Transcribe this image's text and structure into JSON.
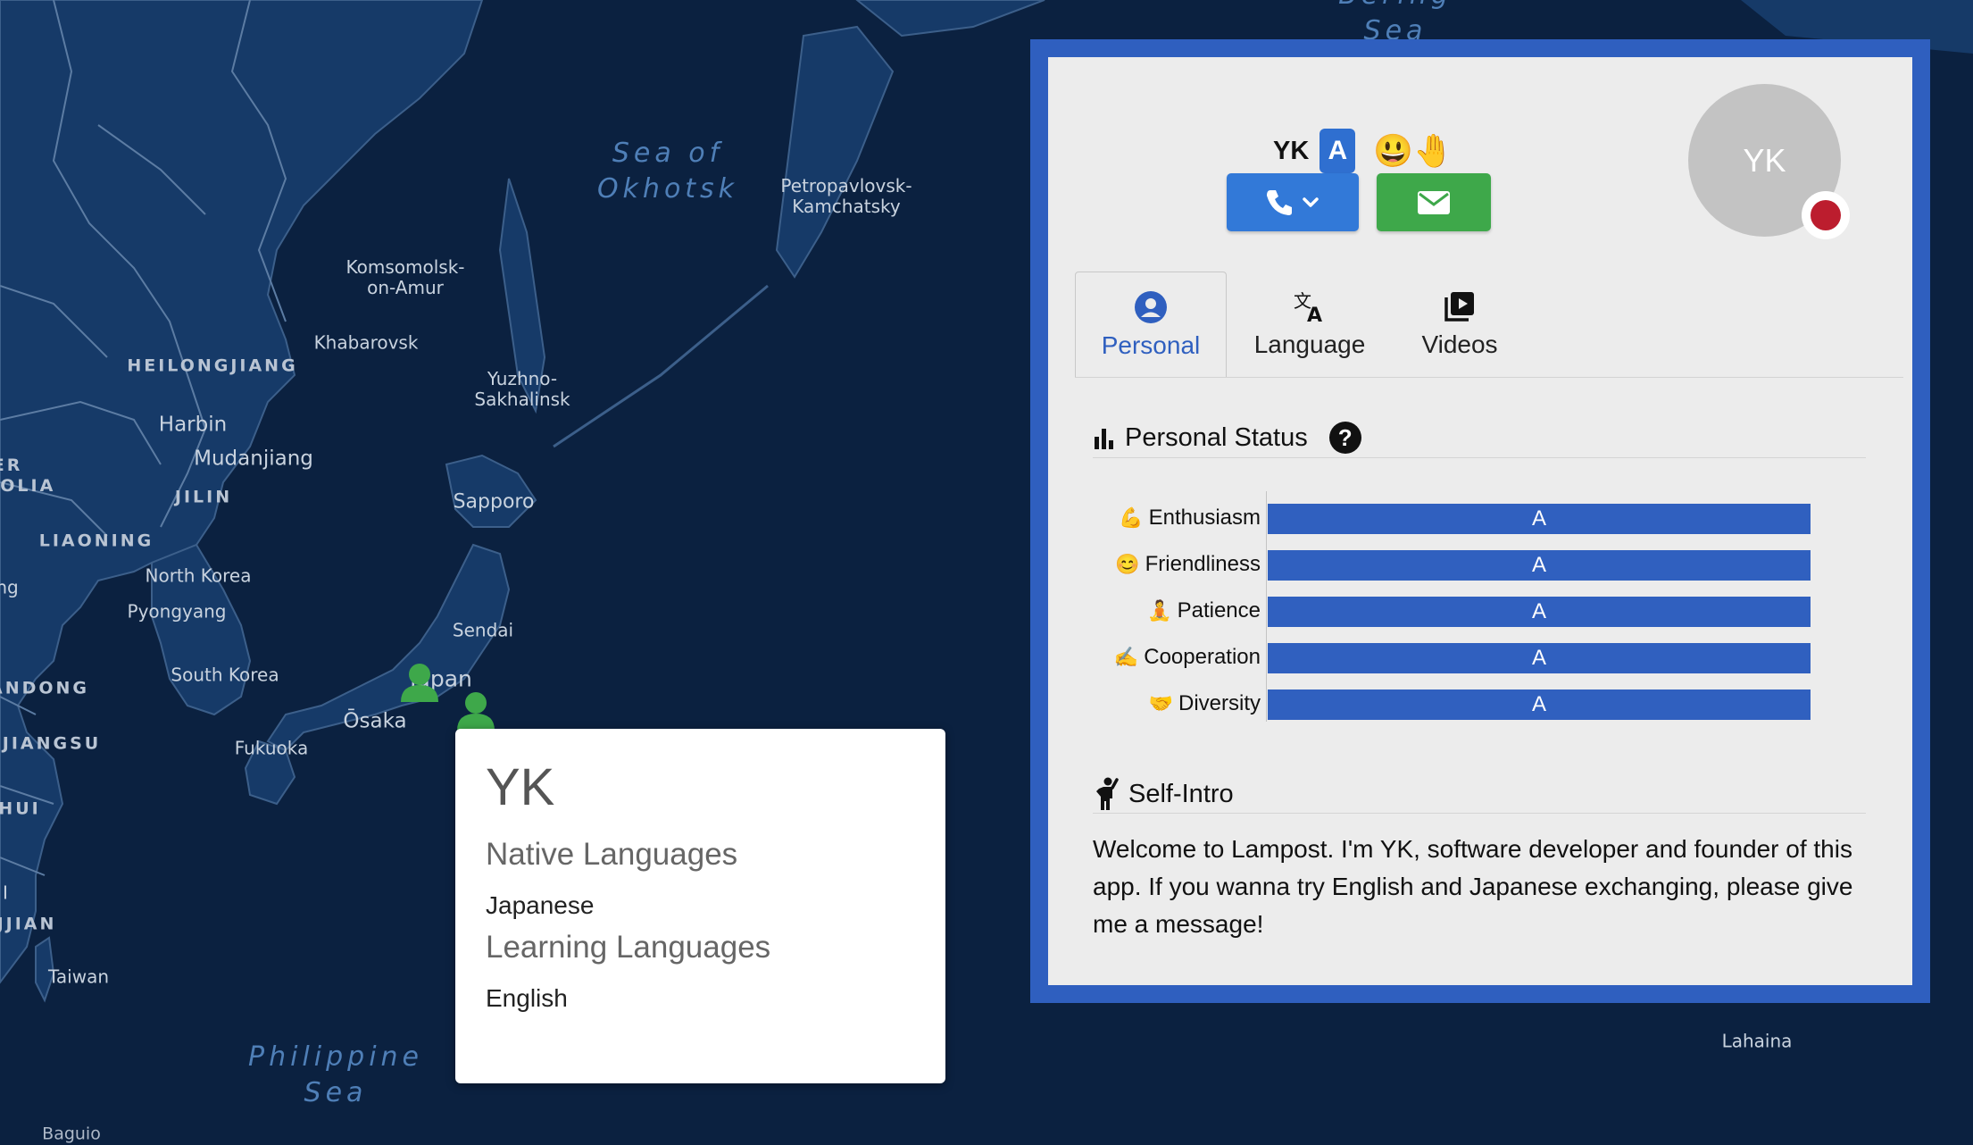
{
  "map": {
    "labels": {
      "bering_sea": "Bering\nSea",
      "sea_of_okhotsk": "Sea of\nOkhotsk",
      "philippine_sea": "Philippine\nSea",
      "petropavlovsk": "Petropavlovsk-\nKamchatsky",
      "komsomolsk": "Komsomolsk-\non-Amur",
      "khabarovsk": "Khabarovsk",
      "yuzhno": "Yuzhno-\nSakhalinsk",
      "heilongjiang": "HEILONGJIANG",
      "harbin": "Harbin",
      "mudanjiang": "Mudanjiang",
      "jilin": "JILIN",
      "liaoning": "LIAONING",
      "inner_mongolia": "IER\nGOLIA",
      "north_korea": "North Korea",
      "pyongyang": "Pyongyang",
      "sapporo": "Sapporo",
      "sendai": "Sendai",
      "japan": "Japan",
      "osaka": "Ōsaka",
      "fukuoka": "Fukuoka",
      "south_korea": "South Korea",
      "shandong": "ANDONG",
      "jiangsu": "JIANGSU",
      "anhui": "HUI",
      "fujian": "JJIAN",
      "taiwan": "Taiwan",
      "lahaina": "Lahaina",
      "baguio": "Baguio",
      "ng": "ng",
      "i": "I"
    }
  },
  "popup": {
    "name": "YK",
    "native_heading": "Native Languages",
    "native_value": "Japanese",
    "learning_heading": "Learning Languages",
    "learning_value": "English"
  },
  "profile": {
    "username": "YK",
    "grade_badge": "A",
    "emojis": "😃🤚",
    "avatar_initials": "YK",
    "tabs": [
      {
        "label": "Personal",
        "icon": "person-circle-icon",
        "active": true
      },
      {
        "label": "Language",
        "icon": "translate-icon",
        "active": false
      },
      {
        "label": "Videos",
        "icon": "video-library-icon",
        "active": false
      }
    ],
    "personal_status_title": "Personal Status",
    "help_symbol": "?",
    "stats": [
      {
        "emoji": "💪",
        "label": "Enthusiasm",
        "grade": "A",
        "fraction": 1.0
      },
      {
        "emoji": "😊",
        "label": "Friendliness",
        "grade": "A",
        "fraction": 1.0
      },
      {
        "emoji": "🧘",
        "label": "Patience",
        "grade": "A",
        "fraction": 1.0
      },
      {
        "emoji": "✍️",
        "label": "Cooperation",
        "grade": "A",
        "fraction": 1.0
      },
      {
        "emoji": "🤝",
        "label": "Diversity",
        "grade": "A",
        "fraction": 1.0
      }
    ],
    "self_intro_title": "Self-Intro",
    "self_intro_text": "Welcome to Lampost. I'm YK, software developer and founder of this app. If you wanna try English and Japanese exchanging, please give me a message!"
  },
  "colors": {
    "map_ocean": "#0b2140",
    "map_land": "#163a68",
    "panel_border": "#2f5fbf",
    "call_button": "#3279d8",
    "mail_button": "#3ea84a",
    "marker": "#3ea84a",
    "flag_red": "#bc1d2e"
  }
}
